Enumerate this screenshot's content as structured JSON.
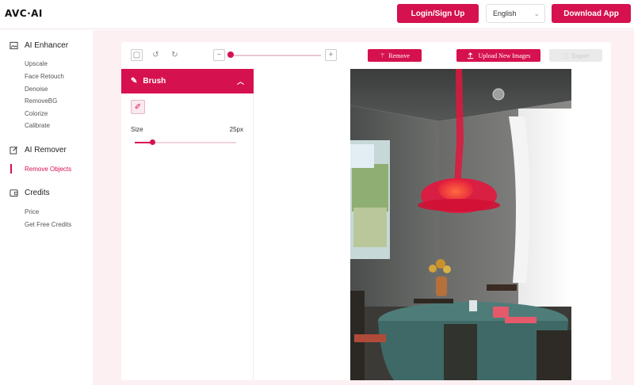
{
  "header": {
    "logo": "AVC·AI",
    "login_label": "Login/Sign Up",
    "language": "English",
    "download_label": "Download App"
  },
  "sidebar": {
    "sections": [
      {
        "title": "AI Enhancer",
        "icon": "image-icon",
        "items": [
          "Upscale",
          "Face Retouch",
          "Denoise",
          "RemoveBG",
          "Colorize",
          "Calibrate"
        ]
      },
      {
        "title": "AI Remover",
        "icon": "edit-icon",
        "items": [
          "Remove Objects"
        ]
      },
      {
        "title": "Credits",
        "icon": "wallet-icon",
        "items": [
          "Price",
          "Get Free Credits"
        ]
      }
    ],
    "active_item": "Remove Objects"
  },
  "toolbar": {
    "remove_label": "Remove",
    "upload_label": "Upload New Images",
    "export_label": "Export"
  },
  "brush": {
    "title": "Brush",
    "size_label": "Size",
    "size_value": "25px",
    "size_fraction": 0.17
  },
  "colors": {
    "accent": "#d6114f",
    "background": "#fdf0f3"
  }
}
